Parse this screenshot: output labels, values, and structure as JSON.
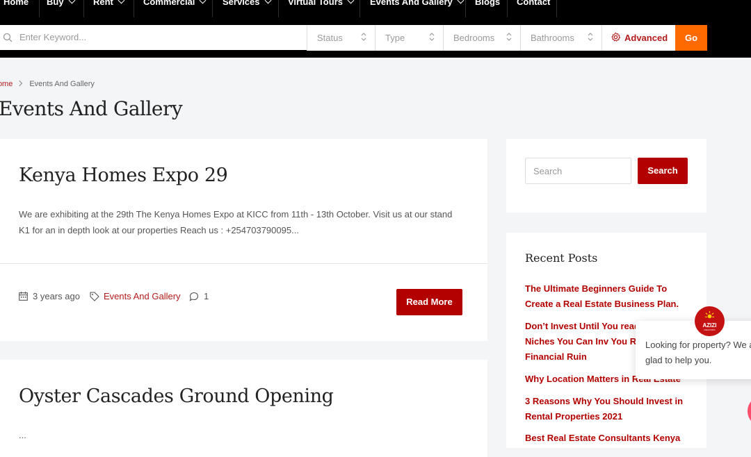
{
  "nav": {
    "items": [
      {
        "label": "Home",
        "dropdown": false
      },
      {
        "label": "Buy",
        "dropdown": true
      },
      {
        "label": "Rent",
        "dropdown": true
      },
      {
        "label": "Commercial",
        "dropdown": true
      },
      {
        "label": "Services",
        "dropdown": true
      },
      {
        "label": "Virtual Tours",
        "dropdown": true
      },
      {
        "label": "Events And Gallery",
        "dropdown": true
      },
      {
        "label": "Blogs",
        "dropdown": false
      },
      {
        "label": "Contact",
        "dropdown": false
      }
    ]
  },
  "search": {
    "keyword_placeholder": "Enter Keyword...",
    "filters": [
      "Status",
      "Type",
      "Bedrooms",
      "Bathrooms"
    ],
    "advanced_label": "Advanced",
    "go_label": "Go"
  },
  "breadcrumb": {
    "home": "Home",
    "current": "Events And Gallery"
  },
  "page_title": "Events And Gallery",
  "posts": [
    {
      "title": "Kenya Homes Expo 29",
      "excerpt": "We are exhibiting at the 29th The Kenya Homes Expo at KICC from 11th - 13th October. Visit us at our stand K1 for an in depth look at our properties Reach us : +254703790095...",
      "date": "3 years ago",
      "category": "Events And Gallery",
      "comments": "1",
      "read_more": "Read More"
    },
    {
      "title": "Oyster Cascades Ground Opening",
      "excerpt": "..."
    }
  ],
  "sidebar": {
    "search_placeholder": "Search",
    "search_button": "Search",
    "recent_title": "Recent Posts",
    "recent_posts": [
      "The Ultimate Beginners Guide To Create a Real Estate Business Plan.",
      "Don’t Invest Until You read Estate Niches You Can Inv You Risk Financial Ruin",
      "Why Location Matters in Real Estate",
      "3 Reasons Why You Should Invest in Rental Properties 2021",
      "Best Real Estate Consultants Kenya"
    ]
  },
  "chat": {
    "message": "Looking for property? We a glad to help you.",
    "logo_text": "AZIZI",
    "logo_subtext": "REALTORS"
  },
  "colors": {
    "brand_red": "#b30000",
    "go_orange": "#ff6a00",
    "nav_bg": "#000000"
  }
}
